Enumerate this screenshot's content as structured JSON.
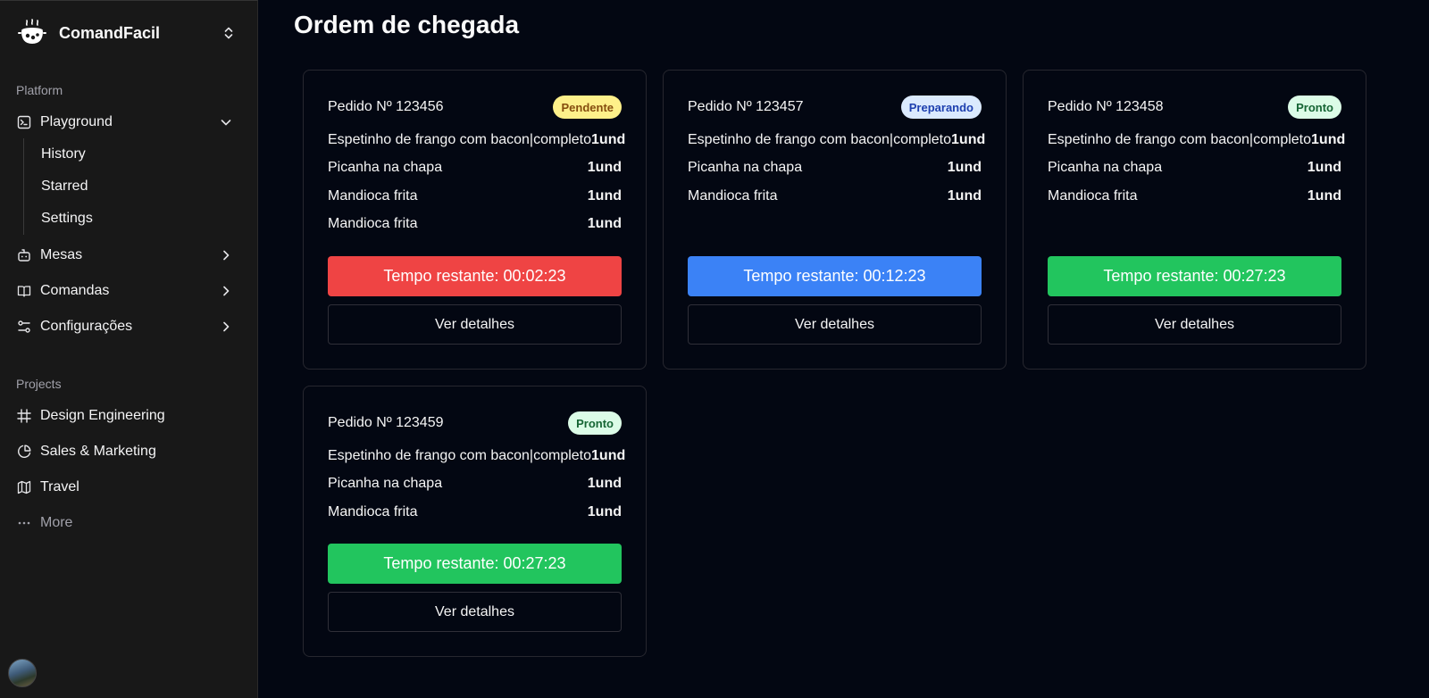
{
  "app": {
    "name": "ComandFacil"
  },
  "sidebar": {
    "platform_label": "Platform",
    "playground": {
      "label": "Playground",
      "icon": "terminal-icon"
    },
    "sub_items": [
      {
        "label": "History"
      },
      {
        "label": "Starred"
      },
      {
        "label": "Settings"
      }
    ],
    "nav_items": [
      {
        "label": "Mesas",
        "icon": "bot-icon"
      },
      {
        "label": "Comandas",
        "icon": "book-icon"
      },
      {
        "label": "Configurações",
        "icon": "settings-sliders-icon"
      }
    ],
    "projects_label": "Projects",
    "projects": [
      {
        "label": "Design Engineering",
        "icon": "frame-icon"
      },
      {
        "label": "Sales & Marketing",
        "icon": "pie-chart-icon"
      },
      {
        "label": "Travel",
        "icon": "map-icon"
      }
    ],
    "more_label": "More"
  },
  "main": {
    "title": "Ordem de chegada",
    "details_label": "Ver detalhes",
    "orders": [
      {
        "number": "Pedido Nº 123456",
        "status": "Pendente",
        "status_color": "#fef08a",
        "status_text_color": "#854d0e",
        "items": [
          {
            "name": "Espetinho de frango com bacon|completo",
            "qty": "1und"
          },
          {
            "name": "Picanha na chapa",
            "qty": "1und"
          },
          {
            "name": "Mandioca frita",
            "qty": "1und"
          },
          {
            "name": "Mandioca frita",
            "qty": "1und"
          }
        ],
        "timer": "Tempo restante: 00:02:23",
        "timer_color": "#ef4444"
      },
      {
        "number": "Pedido Nº 123457",
        "status": "Preparando",
        "status_color": "#dbeafe",
        "status_text_color": "#1e40af",
        "items": [
          {
            "name": "Espetinho de frango com bacon|completo",
            "qty": "1und"
          },
          {
            "name": "Picanha na chapa",
            "qty": "1und"
          },
          {
            "name": "Mandioca frita",
            "qty": "1und"
          }
        ],
        "timer": "Tempo restante: 00:12:23",
        "timer_color": "#3b82f6"
      },
      {
        "number": "Pedido Nº 123458",
        "status": "Pronto",
        "status_color": "#dcfce7",
        "status_text_color": "#166534",
        "items": [
          {
            "name": "Espetinho de frango com bacon|completo",
            "qty": "1und"
          },
          {
            "name": "Picanha na chapa",
            "qty": "1und"
          },
          {
            "name": "Mandioca frita",
            "qty": "1und"
          }
        ],
        "timer": "Tempo restante: 00:27:23",
        "timer_color": "#22c55e"
      },
      {
        "number": "Pedido Nº 123459",
        "status": "Pronto",
        "status_color": "#dcfce7",
        "status_text_color": "#166534",
        "items": [
          {
            "name": "Espetinho de frango com bacon|completo",
            "qty": "1und"
          },
          {
            "name": "Picanha na chapa",
            "qty": "1und"
          },
          {
            "name": "Mandioca frita",
            "qty": "1und"
          }
        ],
        "timer": "Tempo restante: 00:27:23",
        "timer_color": "#22c55e"
      }
    ]
  }
}
